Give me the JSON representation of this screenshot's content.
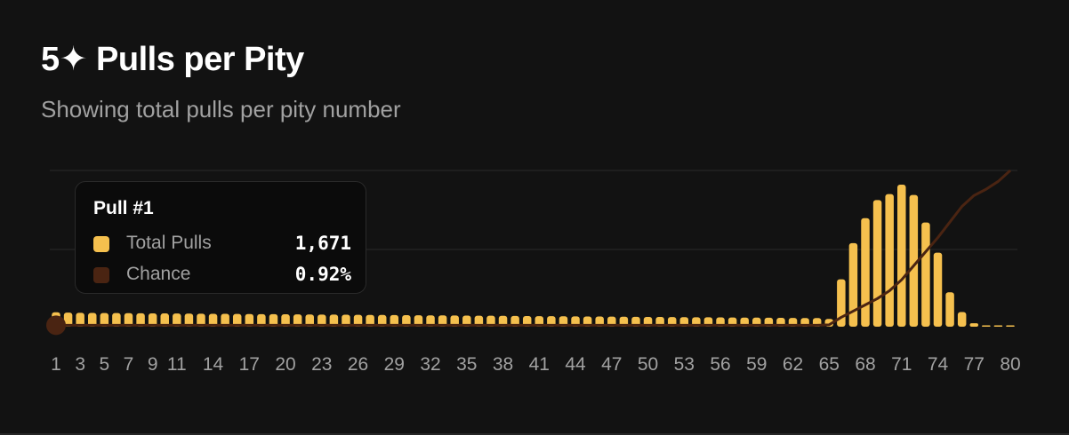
{
  "title": "5✦ Pulls per Pity",
  "subtitle": "Showing total pulls per pity number",
  "colors": {
    "total_pulls": "#f5c04e",
    "chance": "#4a2412",
    "grid": "#2a2a2a",
    "tick": "#a1a1a1"
  },
  "tooltip": {
    "title": "Pull #1",
    "rows": [
      {
        "label": "Total Pulls",
        "value": "1,671"
      },
      {
        "label": "Chance",
        "value": "0.92%"
      }
    ]
  },
  "chart_data": {
    "type": "bar",
    "x": [
      1,
      2,
      3,
      4,
      5,
      6,
      7,
      8,
      9,
      10,
      11,
      12,
      13,
      14,
      15,
      16,
      17,
      18,
      19,
      20,
      21,
      22,
      23,
      24,
      25,
      26,
      27,
      28,
      29,
      30,
      31,
      32,
      33,
      34,
      35,
      36,
      37,
      38,
      39,
      40,
      41,
      42,
      43,
      44,
      45,
      46,
      47,
      48,
      49,
      50,
      51,
      52,
      53,
      54,
      55,
      56,
      57,
      58,
      59,
      60,
      61,
      62,
      63,
      64,
      65,
      66,
      67,
      68,
      69,
      70,
      71,
      72,
      73,
      74,
      75,
      76,
      77,
      78,
      79,
      80
    ],
    "x_tick_labels": [
      "1",
      "3",
      "5",
      "7",
      "9",
      "11",
      "14",
      "17",
      "20",
      "23",
      "26",
      "29",
      "32",
      "35",
      "38",
      "41",
      "44",
      "47",
      "50",
      "53",
      "56",
      "59",
      "62",
      "65",
      "68",
      "71",
      "74",
      "77",
      "80"
    ],
    "series": [
      {
        "name": "Total Pulls",
        "values": [
          1671,
          1640,
          1610,
          1600,
          1590,
          1580,
          1570,
          1560,
          1550,
          1540,
          1530,
          1520,
          1510,
          1500,
          1490,
          1480,
          1470,
          1460,
          1450,
          1440,
          1430,
          1420,
          1410,
          1400,
          1390,
          1380,
          1370,
          1360,
          1350,
          1340,
          1330,
          1320,
          1310,
          1300,
          1290,
          1280,
          1270,
          1260,
          1250,
          1240,
          1230,
          1220,
          1210,
          1200,
          1190,
          1180,
          1170,
          1160,
          1150,
          1140,
          1130,
          1120,
          1110,
          1100,
          1090,
          1080,
          1070,
          1060,
          1050,
          1040,
          1030,
          1020,
          1010,
          1000,
          900,
          5500,
          9700,
          12600,
          14700,
          15400,
          16500,
          15300,
          12100,
          8600,
          4000,
          1700,
          400,
          100,
          30,
          10
        ]
      },
      {
        "name": "Chance",
        "values": [
          0.92,
          0.92,
          0.92,
          0.92,
          0.92,
          0.92,
          0.92,
          0.92,
          0.92,
          0.92,
          0.92,
          0.92,
          0.92,
          0.92,
          0.92,
          0.92,
          0.92,
          0.92,
          0.92,
          0.92,
          0.92,
          0.92,
          0.92,
          0.92,
          0.92,
          0.92,
          0.92,
          0.92,
          0.92,
          0.92,
          0.92,
          0.92,
          0.92,
          0.92,
          0.92,
          0.92,
          0.92,
          0.92,
          0.92,
          0.92,
          0.92,
          0.92,
          0.92,
          0.92,
          0.92,
          0.92,
          0.92,
          0.92,
          0.92,
          0.92,
          0.92,
          0.92,
          0.92,
          0.92,
          0.92,
          0.92,
          0.92,
          0.92,
          0.92,
          0.92,
          0.92,
          0.92,
          0.92,
          0.92,
          1.2,
          6,
          10,
          14,
          18,
          23,
          30,
          39,
          48,
          57,
          67,
          77,
          84,
          88,
          93,
          100
        ]
      }
    ],
    "grid": "horizontal",
    "active_point": 1
  }
}
